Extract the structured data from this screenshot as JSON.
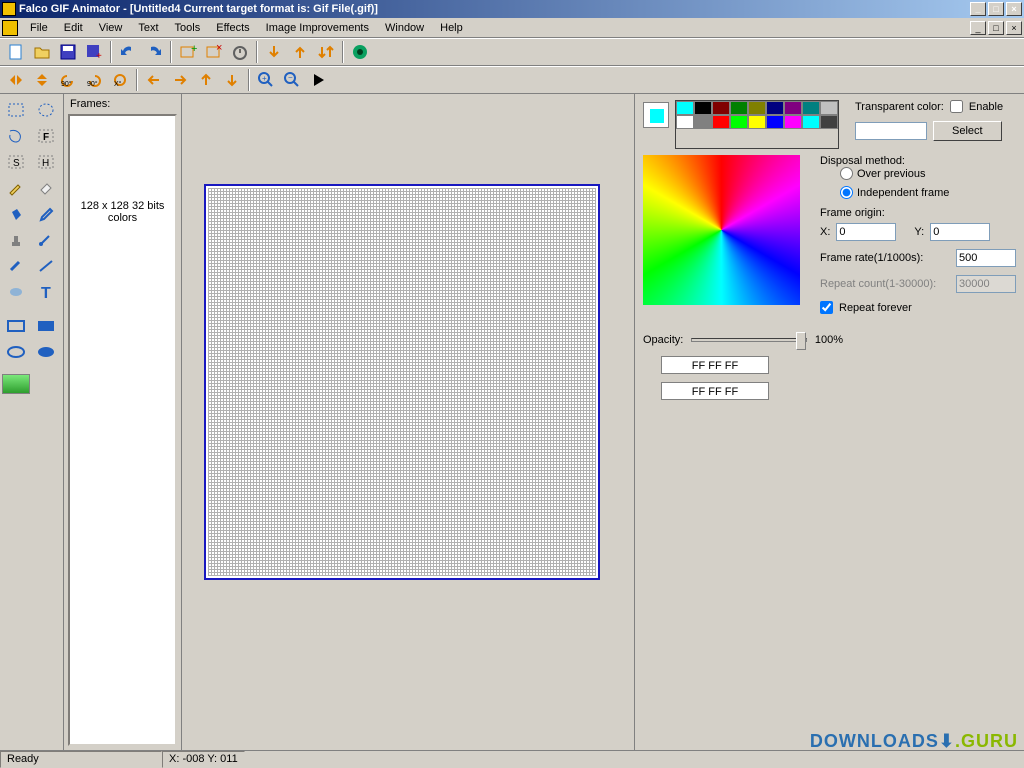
{
  "titlebar": {
    "text": "Falco GIF Animator - [Untitled4  Current target format is: Gif File(.gif)]"
  },
  "menus": {
    "file": "File",
    "edit": "Edit",
    "view": "View",
    "text": "Text",
    "tools": "Tools",
    "effects": "Effects",
    "image_improvements": "Image Improvements",
    "window": "Window",
    "help": "Help"
  },
  "frames": {
    "label": "Frames:",
    "info": "128 x 128 32 bits colors"
  },
  "right": {
    "transparent_label": "Transparent color:",
    "enable": "Enable",
    "select": "Select",
    "disposal_label": "Disposal method:",
    "disposal_over": "Over previous",
    "disposal_indep": "Independent frame",
    "frame_origin": "Frame origin:",
    "x_label": "X:",
    "x_value": "0",
    "y_label": "Y:",
    "y_value": "0",
    "frame_rate_label": "Frame rate(1/1000s):",
    "frame_rate_value": "500",
    "repeat_count_label": "Repeat count(1-30000):",
    "repeat_count_value": "30000",
    "repeat_forever": "Repeat forever",
    "opacity_label": "Opacity:",
    "opacity_value": "100%",
    "hex1": "FF FF FF",
    "hex2": "FF FF FF"
  },
  "palette": [
    "#00ffff",
    "#000000",
    "#800000",
    "#008000",
    "#808000",
    "#000080",
    "#800080",
    "#008080",
    "#c0c0c0",
    "#ffffff",
    "#808080",
    "#ff0000",
    "#00ff00",
    "#ffff00",
    "#0000ff",
    "#ff00ff",
    "#00ffff",
    "#404040"
  ],
  "status": {
    "ready": "Ready",
    "coords": "X: -008 Y: 011"
  },
  "watermark": {
    "d": "DOWNLOADS",
    "g": ".GURU"
  }
}
